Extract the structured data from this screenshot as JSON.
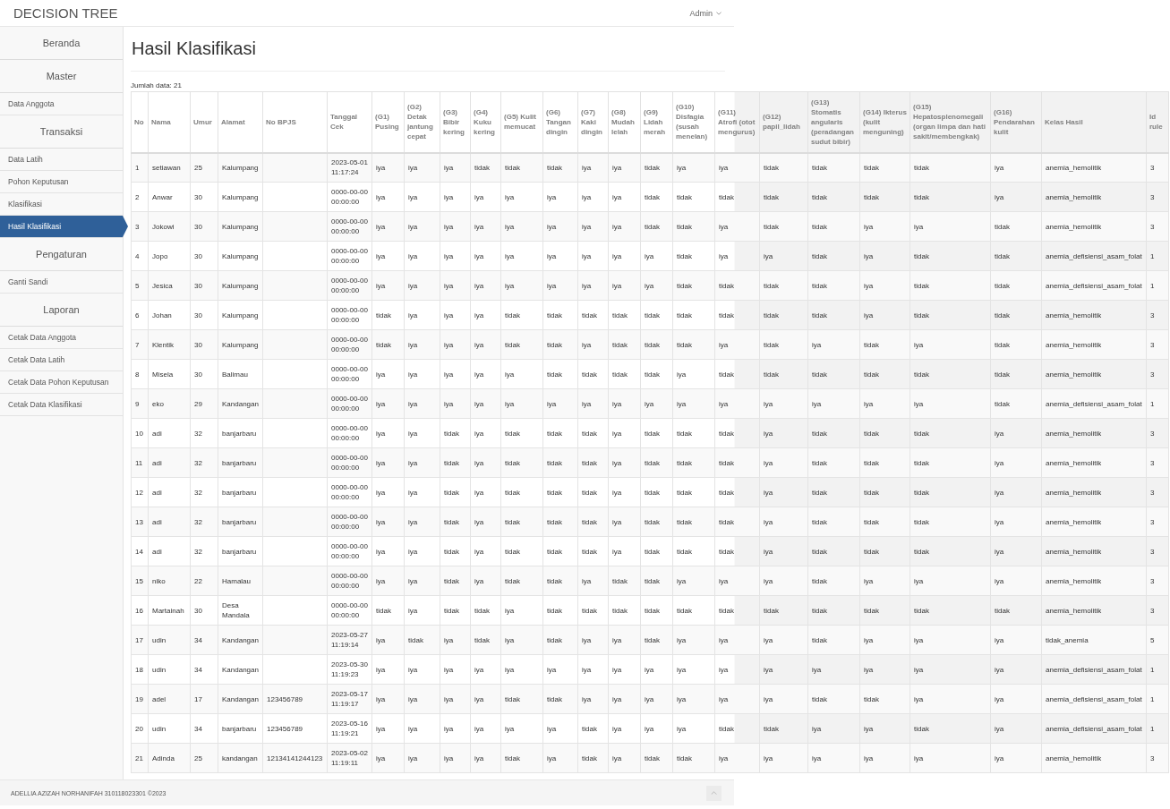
{
  "navbar": {
    "brand": "DECISION TREE",
    "user_menu": "Admin"
  },
  "sidebar": {
    "items": [
      {
        "kind": "heading",
        "label": "Beranda",
        "selected": false
      },
      {
        "kind": "heading",
        "label": "Master",
        "selected": false
      },
      {
        "kind": "link",
        "label": "Data Anggota",
        "selected": false
      },
      {
        "kind": "heading",
        "label": "Transaksi",
        "selected": false
      },
      {
        "kind": "link",
        "label": "Data Latih",
        "selected": false
      },
      {
        "kind": "link",
        "label": "Pohon Keputusan",
        "selected": false
      },
      {
        "kind": "link",
        "label": "Klasifikasi",
        "selected": false
      },
      {
        "kind": "link",
        "label": "Hasil Klasifikasi",
        "selected": true
      },
      {
        "kind": "heading",
        "label": "Pengaturan",
        "selected": false
      },
      {
        "kind": "link",
        "label": "Ganti Sandi",
        "selected": false
      },
      {
        "kind": "heading",
        "label": "Laporan",
        "selected": false
      },
      {
        "kind": "link",
        "label": "Cetak Data Anggota",
        "selected": false
      },
      {
        "kind": "link",
        "label": "Cetak Data Latih",
        "selected": false
      },
      {
        "kind": "link",
        "label": "Cetak Data Pohon Keputusan",
        "selected": false
      },
      {
        "kind": "link",
        "label": "Cetak Data Klasifikasi",
        "selected": false
      }
    ]
  },
  "page": {
    "title": "Hasil Klasifikasi",
    "record_count": "Jumlah data: 21"
  },
  "table": {
    "columns": [
      "No",
      "Nama",
      "Umur",
      "Alamat",
      "No BPJS",
      "Tanggal Cek",
      "(G1) Pusing",
      "(G2) Detak jantung cepat",
      "(G3) Bibir kering",
      "(G4) Kuku kering",
      "(G5) Kulit memucat",
      "(G6) Tangan dingin",
      "(G7) Kaki dingin",
      "(G8) Mudah lelah",
      "(G9) Lidah merah",
      "(G10) Disfagia (susah menelan)",
      "(G11) Atrofi (otot mengurus)",
      "(G12) papil_lidah",
      "(G13) Stomatis angularis (peradangan sudut bibir)",
      "(G14) Ikterus (kulit menguning)",
      "(G15) Hepatosplenomegali (organ limpa dan hati sakit/membengkak)",
      "(G16) Pendarahan kulit",
      "Kelas Hasil",
      "Id rule"
    ],
    "rows": [
      {
        "no": "1",
        "nama": "setiawan",
        "umur": "25",
        "alamat": "Kalumpang",
        "tanggal_cek": "2023-05-01 11:17:24",
        "gejala": [
          "iya",
          "iya",
          "iya",
          "tidak",
          "tidak",
          "tidak",
          "iya",
          "iya",
          "tidak",
          "iya",
          "iya",
          "tidak",
          "tidak",
          "tidak",
          "tidak",
          "iya"
        ],
        "kelas_hasil": "anemia_hemolitik",
        "id_rule": "3"
      },
      {
        "no": "2",
        "nama": "Anwar",
        "umur": "30",
        "alamat": "Kalumpang",
        "tanggal_cek": "0000-00-00 00:00:00",
        "gejala": [
          "iya",
          "iya",
          "iya",
          "iya",
          "iya",
          "iya",
          "iya",
          "iya",
          "tidak",
          "tidak",
          "tidak",
          "tidak",
          "tidak",
          "tidak",
          "tidak",
          "iya"
        ],
        "kelas_hasil": "anemia_hemolitik",
        "id_rule": "3"
      },
      {
        "no": "3",
        "nama": "Jokowi",
        "umur": "30",
        "alamat": "Kalumpang",
        "tanggal_cek": "0000-00-00 00:00:00",
        "gejala": [
          "iya",
          "iya",
          "iya",
          "iya",
          "iya",
          "iya",
          "iya",
          "iya",
          "tidak",
          "tidak",
          "iya",
          "tidak",
          "tidak",
          "iya",
          "iya",
          "tidak"
        ],
        "kelas_hasil": "anemia_hemolitik",
        "id_rule": "3"
      },
      {
        "no": "4",
        "nama": "Jopo",
        "umur": "30",
        "alamat": "Kalumpang",
        "tanggal_cek": "0000-00-00 00:00:00",
        "gejala": [
          "iya",
          "iya",
          "iya",
          "iya",
          "iya",
          "iya",
          "iya",
          "iya",
          "iya",
          "tidak",
          "iya",
          "iya",
          "tidak",
          "iya",
          "tidak",
          "tidak"
        ],
        "kelas_hasil": "anemia_defisiensi_asam_folat",
        "id_rule": "1"
      },
      {
        "no": "5",
        "nama": "Jesica",
        "umur": "30",
        "alamat": "Kalumpang",
        "tanggal_cek": "0000-00-00 00:00:00",
        "gejala": [
          "iya",
          "iya",
          "iya",
          "iya",
          "iya",
          "iya",
          "iya",
          "iya",
          "iya",
          "tidak",
          "tidak",
          "tidak",
          "tidak",
          "iya",
          "tidak",
          "tidak"
        ],
        "kelas_hasil": "anemia_defisiensi_asam_folat",
        "id_rule": "1"
      },
      {
        "no": "6",
        "nama": "Johan",
        "umur": "30",
        "alamat": "Kalumpang",
        "tanggal_cek": "0000-00-00 00:00:00",
        "gejala": [
          "tidak",
          "iya",
          "iya",
          "iya",
          "tidak",
          "tidak",
          "tidak",
          "tidak",
          "tidak",
          "tidak",
          "tidak",
          "tidak",
          "tidak",
          "iya",
          "tidak",
          "tidak"
        ],
        "kelas_hasil": "anemia_hemolitik",
        "id_rule": "3"
      },
      {
        "no": "7",
        "nama": "Klentik",
        "umur": "30",
        "alamat": "Kalumpang",
        "tanggal_cek": "0000-00-00 00:00:00",
        "gejala": [
          "tidak",
          "iya",
          "iya",
          "iya",
          "tidak",
          "tidak",
          "iya",
          "tidak",
          "tidak",
          "tidak",
          "iya",
          "tidak",
          "iya",
          "tidak",
          "iya",
          "tidak"
        ],
        "kelas_hasil": "anemia_hemolitik",
        "id_rule": "3"
      },
      {
        "no": "8",
        "nama": "Misela",
        "umur": "30",
        "alamat": "Balimau",
        "tanggal_cek": "0000-00-00 00:00:00",
        "gejala": [
          "iya",
          "iya",
          "iya",
          "iya",
          "iya",
          "tidak",
          "tidak",
          "tidak",
          "tidak",
          "iya",
          "tidak",
          "tidak",
          "tidak",
          "tidak",
          "tidak",
          "tidak"
        ],
        "kelas_hasil": "anemia_hemolitik",
        "id_rule": "3"
      },
      {
        "no": "9",
        "nama": "eko",
        "umur": "29",
        "alamat": "Kandangan",
        "tanggal_cek": "0000-00-00 00:00:00",
        "gejala": [
          "iya",
          "iya",
          "iya",
          "iya",
          "iya",
          "iya",
          "iya",
          "iya",
          "iya",
          "iya",
          "iya",
          "iya",
          "iya",
          "iya",
          "iya",
          "tidak"
        ],
        "kelas_hasil": "anemia_defisiensi_asam_folat",
        "id_rule": "1"
      },
      {
        "no": "10",
        "nama": "adi",
        "umur": "32",
        "alamat": "banjarbaru",
        "tanggal_cek": "0000-00-00 00:00:00",
        "gejala": [
          "iya",
          "iya",
          "tidak",
          "iya",
          "tidak",
          "tidak",
          "tidak",
          "iya",
          "tidak",
          "tidak",
          "tidak",
          "iya",
          "tidak",
          "tidak",
          "tidak",
          "iya"
        ],
        "kelas_hasil": "anemia_hemolitik",
        "id_rule": "3"
      },
      {
        "no": "11",
        "nama": "adi",
        "umur": "32",
        "alamat": "banjarbaru",
        "tanggal_cek": "0000-00-00 00:00:00",
        "gejala": [
          "iya",
          "iya",
          "tidak",
          "iya",
          "tidak",
          "tidak",
          "tidak",
          "iya",
          "tidak",
          "tidak",
          "tidak",
          "iya",
          "tidak",
          "tidak",
          "tidak",
          "iya"
        ],
        "kelas_hasil": "anemia_hemolitik",
        "id_rule": "3"
      },
      {
        "no": "12",
        "nama": "adi",
        "umur": "32",
        "alamat": "banjarbaru",
        "tanggal_cek": "0000-00-00 00:00:00",
        "gejala": [
          "iya",
          "iya",
          "tidak",
          "iya",
          "tidak",
          "tidak",
          "tidak",
          "iya",
          "tidak",
          "tidak",
          "tidak",
          "iya",
          "tidak",
          "tidak",
          "tidak",
          "iya"
        ],
        "kelas_hasil": "anemia_hemolitik",
        "id_rule": "3"
      },
      {
        "no": "13",
        "nama": "adi",
        "umur": "32",
        "alamat": "banjarbaru",
        "tanggal_cek": "0000-00-00 00:00:00",
        "gejala": [
          "iya",
          "iya",
          "tidak",
          "iya",
          "tidak",
          "tidak",
          "tidak",
          "iya",
          "tidak",
          "tidak",
          "tidak",
          "iya",
          "tidak",
          "tidak",
          "tidak",
          "iya"
        ],
        "kelas_hasil": "anemia_hemolitik",
        "id_rule": "3"
      },
      {
        "no": "14",
        "nama": "adi",
        "umur": "32",
        "alamat": "banjarbaru",
        "tanggal_cek": "0000-00-00 00:00:00",
        "gejala": [
          "iya",
          "iya",
          "tidak",
          "iya",
          "tidak",
          "tidak",
          "tidak",
          "iya",
          "tidak",
          "tidak",
          "tidak",
          "iya",
          "tidak",
          "tidak",
          "tidak",
          "iya"
        ],
        "kelas_hasil": "anemia_hemolitik",
        "id_rule": "3"
      },
      {
        "no": "15",
        "nama": "niko",
        "umur": "22",
        "alamat": "Hamalau",
        "tanggal_cek": "0000-00-00 00:00:00",
        "gejala": [
          "iya",
          "iya",
          "tidak",
          "iya",
          "tidak",
          "tidak",
          "iya",
          "tidak",
          "tidak",
          "iya",
          "iya",
          "iya",
          "tidak",
          "iya",
          "iya",
          "iya"
        ],
        "kelas_hasil": "anemia_hemolitik",
        "id_rule": "3"
      },
      {
        "no": "16",
        "nama": "Martainah",
        "umur": "30",
        "alamat": "Desa Mandala",
        "tanggal_cek": "0000-00-00 00:00:00",
        "gejala": [
          "tidak",
          "iya",
          "tidak",
          "tidak",
          "iya",
          "tidak",
          "tidak",
          "tidak",
          "tidak",
          "tidak",
          "tidak",
          "tidak",
          "tidak",
          "tidak",
          "tidak",
          "tidak"
        ],
        "kelas_hasil": "anemia_hemolitik",
        "id_rule": "3"
      },
      {
        "no": "17",
        "nama": "udin",
        "umur": "34",
        "alamat": "Kandangan",
        "tanggal_cek": "2023-05-27 11:19:14",
        "gejala": [
          "iya",
          "tidak",
          "iya",
          "tidak",
          "iya",
          "tidak",
          "iya",
          "iya",
          "tidak",
          "iya",
          "iya",
          "iya",
          "tidak",
          "iya",
          "iya",
          "iya"
        ],
        "kelas_hasil": "tidak_anemia",
        "id_rule": "5"
      },
      {
        "no": "18",
        "nama": "udin",
        "umur": "34",
        "alamat": "Kandangan",
        "tanggal_cek": "2023-05-30 11:19:23",
        "gejala": [
          "iya",
          "iya",
          "iya",
          "iya",
          "iya",
          "iya",
          "iya",
          "iya",
          "iya",
          "iya",
          "iya",
          "iya",
          "iya",
          "iya",
          "iya",
          "iya"
        ],
        "kelas_hasil": "anemia_defisiensi_asam_folat",
        "id_rule": "1"
      },
      {
        "no": "19",
        "nama": "adel",
        "umur": "17",
        "alamat": "Kandangan",
        "no_bpjs": "123456789",
        "tanggal_cek": "2023-05-17 11:19:17",
        "gejala": [
          "iya",
          "iya",
          "iya",
          "iya",
          "tidak",
          "tidak",
          "iya",
          "iya",
          "iya",
          "iya",
          "iya",
          "iya",
          "tidak",
          "tidak",
          "iya",
          "iya"
        ],
        "kelas_hasil": "anemia_defisiensi_asam_folat",
        "id_rule": "1"
      },
      {
        "no": "20",
        "nama": "udin",
        "umur": "34",
        "alamat": "banjarbaru",
        "no_bpjs": "123456789",
        "tanggal_cek": "2023-05-16 11:19:21",
        "gejala": [
          "iya",
          "iya",
          "iya",
          "iya",
          "iya",
          "iya",
          "tidak",
          "iya",
          "iya",
          "iya",
          "tidak",
          "tidak",
          "iya",
          "iya",
          "tidak",
          "iya"
        ],
        "kelas_hasil": "anemia_defisiensi_asam_folat",
        "id_rule": "1"
      },
      {
        "no": "21",
        "nama": "Adinda",
        "umur": "25",
        "alamat": "kandangan",
        "no_bpjs": "12134141244123",
        "tanggal_cek": "2023-05-02 11:19:11",
        "gejala": [
          "iya",
          "iya",
          "iya",
          "iya",
          "tidak",
          "iya",
          "tidak",
          "iya",
          "tidak",
          "tidak",
          "iya",
          "iya",
          "iya",
          "iya",
          "iya",
          "iya"
        ],
        "kelas_hasil": "anemia_hemolitik",
        "id_rule": "3"
      }
    ]
  },
  "footer": {
    "text": "ADELLIA AZIZAH NORHANIFAH 310118023301 ©2023"
  }
}
